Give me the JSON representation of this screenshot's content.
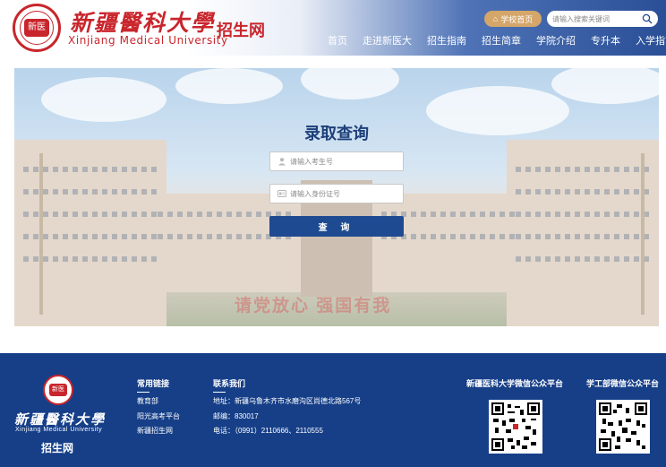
{
  "header": {
    "logo_name_cn": "新疆醫科大學",
    "logo_name_en": "Xinjiang Medical University",
    "site_name": "招生网",
    "seal_text": "新医",
    "home_button": "学校首页",
    "search_placeholder": "请输入搜索关键词"
  },
  "nav": {
    "items": [
      "首页",
      "走进新医大",
      "招生指南",
      "招生简章",
      "学院介绍",
      "专升本",
      "入学指南"
    ]
  },
  "query": {
    "title": "录取查询",
    "exam_no_placeholder": "请输入考生号",
    "id_no_placeholder": "请输入身份证号",
    "submit_label": "查 询"
  },
  "banner": {
    "slogan": "请党放心  强国有我"
  },
  "footer": {
    "logo_name_cn": "新疆醫科大學",
    "logo_name_en": "Xinjiang Medical University",
    "site_name": "招生网",
    "seal_text": "新医",
    "links_title": "常用链接",
    "links": [
      "教育部",
      "阳光高考平台",
      "新疆招生网"
    ],
    "contact_title": "联系我们",
    "address": "地址：新疆乌鲁木齐市水磨沟区尚德北路567号",
    "postcode": "邮编：830017",
    "phone": "电话：（0991）2110666、2110555",
    "qr1_title": "新疆医科大学微信公众平台",
    "qr2_title": "学工部微信公众平台"
  },
  "colors": {
    "brand_red": "#c9252c",
    "brand_blue": "#163f88",
    "button_blue": "#1e4a91",
    "gold": "#d4a66a"
  }
}
